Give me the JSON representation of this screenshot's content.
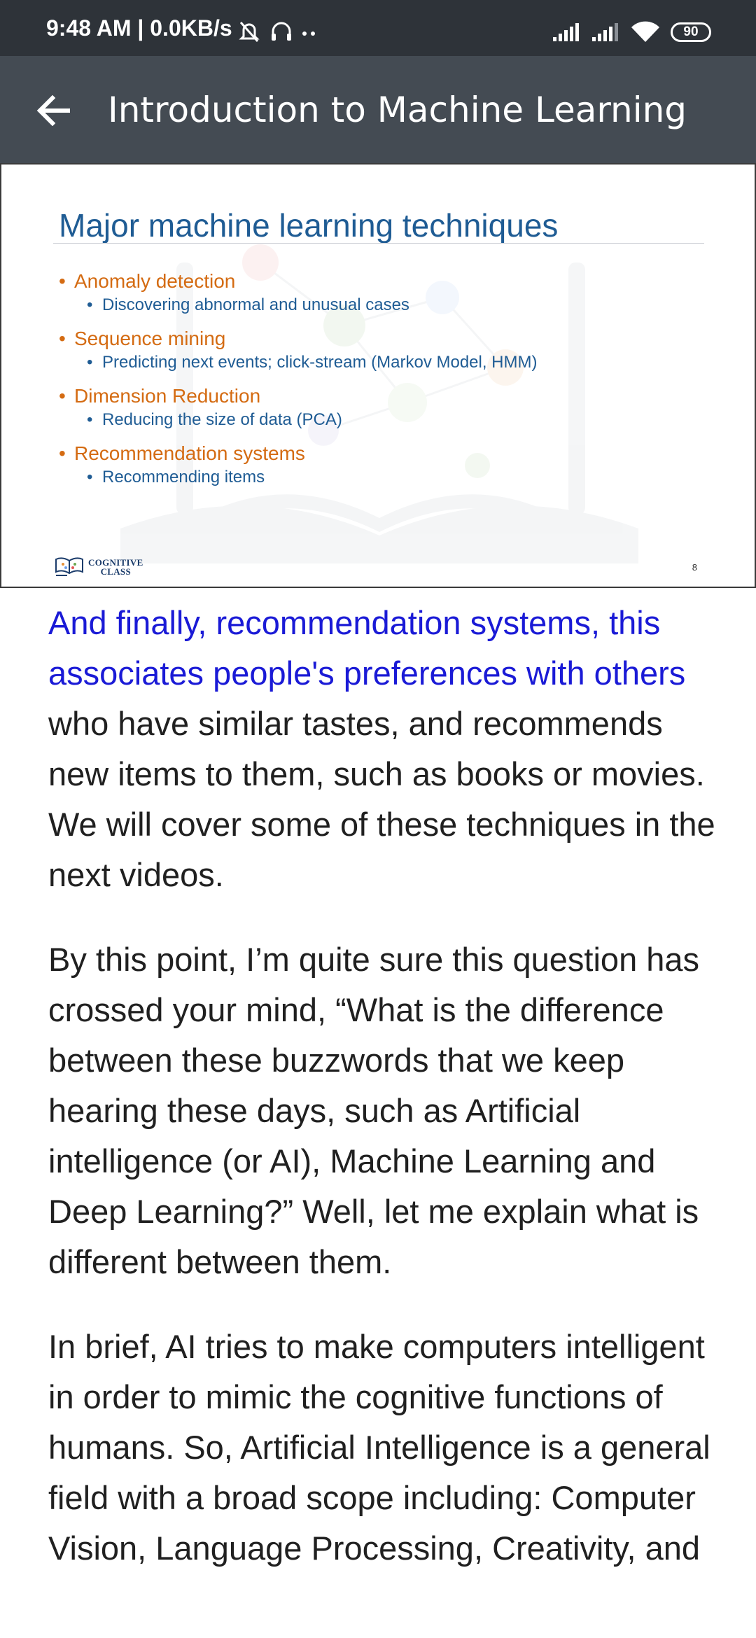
{
  "status_bar": {
    "time": "9:48 AM | 0.0KB/s",
    "battery": "90",
    "icons": [
      "mute-icon",
      "headset-icon",
      "more-dots-icon",
      "signal-icon",
      "signal-icon-2",
      "wifi-icon",
      "battery-icon"
    ]
  },
  "app_bar": {
    "title": "Introduction to Machine Learning",
    "back_icon": "arrow-left-icon"
  },
  "slide": {
    "title": "Major machine learning techniques",
    "items": [
      {
        "label": "Anomaly detection",
        "sub": "Discovering abnormal and unusual cases"
      },
      {
        "label": "Sequence mining",
        "sub": "Predicting next events; click-stream (Markov Model, HMM)"
      },
      {
        "label": "Dimension Reduction",
        "sub": "Reducing the size of data (PCA)"
      },
      {
        "label": "Recommendation systems",
        "sub": "Recommending items"
      }
    ],
    "logo_line1": "COGNITIVE",
    "logo_line2": "CLASS",
    "page_number": "8",
    "colors": {
      "title": "#1f5c94",
      "bullet": "#d46b12",
      "sub": "#1f5c94"
    }
  },
  "article": {
    "p1_highlight": "And finally, recommendation systems, this associates people's preferences with others",
    "p1_rest": " who have similar tastes, and recommends new items to them, such as books or movies. We will cover some of these techniques in the next videos.",
    "p2": "By this point, I’m quite sure this question has crossed your mind, “What is the difference between these buzzwords that we keep hearing these days, such as Artificial intelligence (or AI), Machine Learning and Deep Learning?” Well, let me explain what is different between them.",
    "p3": "In brief, AI tries to make computers intelligent in order to mimic the cognitive functions of humans. So, Artificial Intelligence is a general field with a broad scope including: Computer Vision, Language Processing, Creativity, and",
    "highlight_color": "#1a1ad6"
  }
}
